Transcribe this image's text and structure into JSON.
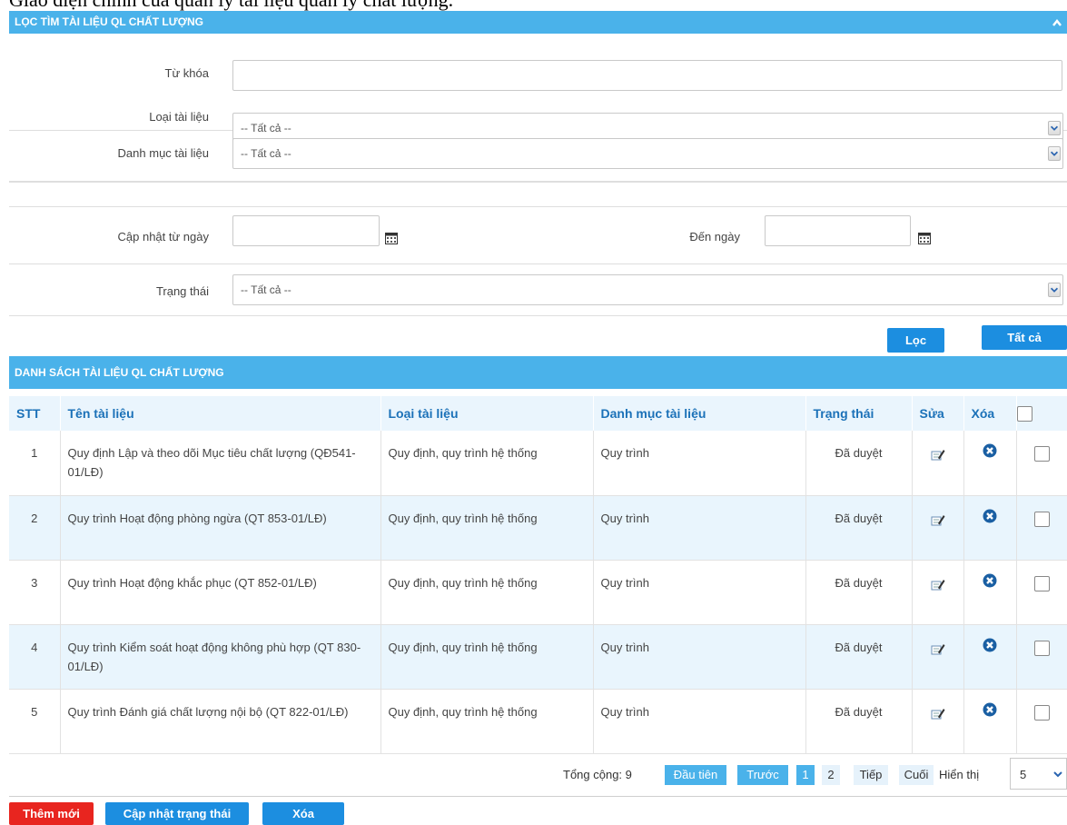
{
  "caption": "Giao diện chính của quản lý tài liệu quản lý chất lượng.",
  "filter": {
    "title": "LỌC TÌM TÀI LIỆU QL CHẤT LƯỢNG",
    "keyword_label": "Từ khóa",
    "keyword_value": "",
    "doc_type_label": "Loại tài liệu",
    "doc_type_value": "-- Tất cả --",
    "category_label": "Danh mục tài liệu",
    "category_value": "-- Tất cả --",
    "from_date_label": "Cập nhật từ ngày",
    "to_date_label": "Đến ngày",
    "from_date_value": "",
    "to_date_value": "",
    "status_label": "Trạng thái",
    "status_value": "-- Tất cả --",
    "filter_button": "Lọc",
    "all_button": "Tất cả"
  },
  "list": {
    "title": "DANH SÁCH TÀI LIỆU QL CHẤT LƯỢNG",
    "columns": [
      "STT",
      "Tên tài liệu",
      "Loại tài liệu",
      "Danh mục tài liệu",
      "Trạng thái",
      "Sửa",
      "Xóa"
    ],
    "rows": [
      {
        "stt": "1",
        "name": "Quy định Lập và theo dõi Mục tiêu chất lượng (QĐ541-01/LĐ)",
        "type": "Quy định, quy trình hệ thống",
        "category": "Quy trình",
        "status": "Đã duyệt"
      },
      {
        "stt": "2",
        "name": "Quy trình Hoạt động phòng ngừa (QT 853-01/LĐ)",
        "type": "Quy định, quy trình hệ thống",
        "category": "Quy trình",
        "status": "Đã duyệt"
      },
      {
        "stt": "3",
        "name": "Quy trình Hoạt động khắc phục (QT 852-01/LĐ)",
        "type": "Quy định, quy trình hệ thống",
        "category": "Quy trình",
        "status": "Đã duyệt"
      },
      {
        "stt": "4",
        "name": "Quy trình Kiểm soát hoạt động không phù hợp (QT 830-01/LĐ)",
        "type": "Quy định, quy trình hệ thống",
        "category": "Quy trình",
        "status": "Đã duyệt"
      },
      {
        "stt": "5",
        "name": "Quy trình Đánh giá chất lượng nội bộ (QT 822-01/LĐ)",
        "type": "Quy định, quy trình hệ thống",
        "category": "Quy trình",
        "status": "Đã duyệt"
      }
    ]
  },
  "pager": {
    "total": "Tổng cộng: 9",
    "first": "Đầu tiên",
    "prev": "Trước",
    "page1": "1",
    "page2": "2",
    "next": "Tiếp",
    "last": "Cuối",
    "show_label": "Hiển thị",
    "page_size": "5"
  },
  "footer": {
    "add": "Thêm mới",
    "update_status": "Cập nhật trạng thái",
    "delete": "Xóa"
  },
  "colors": {
    "header_blue": "#4ab2ea",
    "button_blue": "#1c8ee0",
    "add_red": "#e8251f",
    "delete_icon": "#1a5fa3"
  }
}
